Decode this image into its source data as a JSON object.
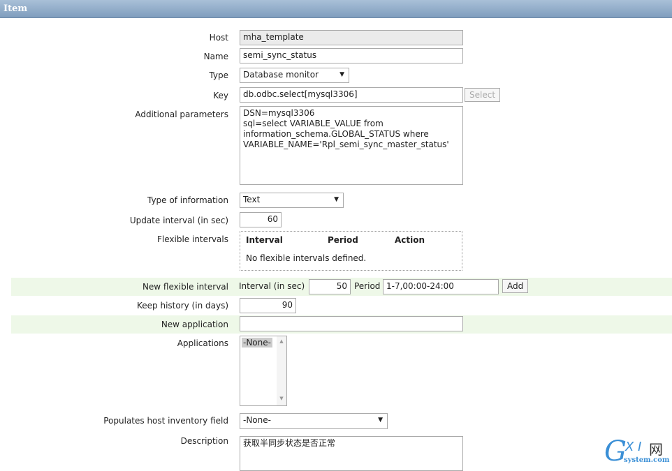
{
  "header": {
    "title": "Item"
  },
  "form": {
    "host": {
      "label": "Host",
      "value": "mha_template"
    },
    "name": {
      "label": "Name",
      "value": "semi_sync_status"
    },
    "type": {
      "label": "Type",
      "value": "Database monitor"
    },
    "key": {
      "label": "Key",
      "value": "db.odbc.select[mysql3306]",
      "button": "Select"
    },
    "params": {
      "label": "Additional parameters",
      "lines": [
        "DSN=mysql3306",
        "sql=select VARIABLE_VALUE from",
        "information_schema.GLOBAL_STATUS where",
        "VARIABLE_NAME='Rpl_semi_sync_master_status'"
      ]
    },
    "info_type": {
      "label": "Type of information",
      "value": "Text"
    },
    "update": {
      "label": "Update interval (in sec)",
      "value": "60"
    },
    "flex": {
      "label": "Flexible intervals",
      "columns": [
        "Interval",
        "Period",
        "Action"
      ],
      "empty": "No flexible intervals defined."
    },
    "new_flex": {
      "label": "New flexible interval",
      "interval_label": "Interval (in sec)",
      "interval": "50",
      "period_label": "Period",
      "period": "1-7,00:00-24:00",
      "add": "Add"
    },
    "history": {
      "label": "Keep history (in days)",
      "value": "90"
    },
    "new_app": {
      "label": "New application",
      "value": ""
    },
    "apps": {
      "label": "Applications",
      "options": [
        "-None-"
      ]
    },
    "inventory": {
      "label": "Populates host inventory field",
      "value": "-None-"
    },
    "description": {
      "label": "Description",
      "value": "获取半同步状态是否正常"
    }
  },
  "watermark": {
    "text": "GXI网 system.com"
  }
}
